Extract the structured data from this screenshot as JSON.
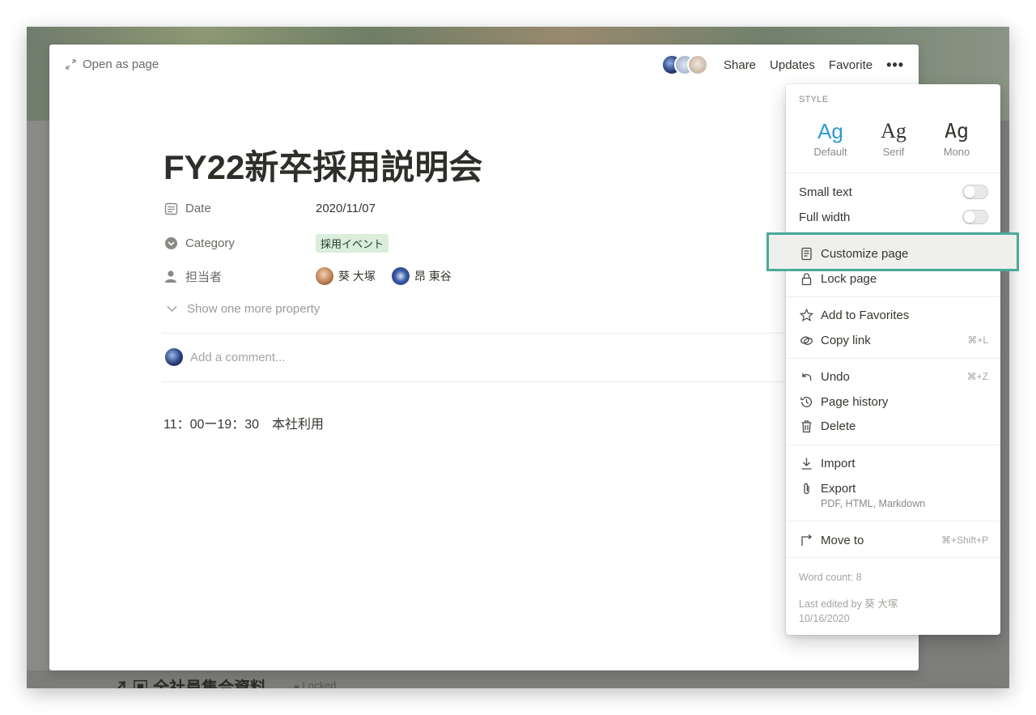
{
  "background": {
    "behind_title": "全社員集合資料",
    "behind_badge": "Locked"
  },
  "topbar": {
    "open_as_page": "Open as page",
    "share": "Share",
    "updates": "Updates",
    "favorite": "Favorite",
    "more": "•••"
  },
  "page": {
    "title": "FY22新卒採用説明会",
    "properties": [
      {
        "name": "Date",
        "icon": "calendar-icon",
        "value": "2020/11/07"
      },
      {
        "name": "Category",
        "icon": "select-icon",
        "value": "採用イベント"
      },
      {
        "name": "担当者",
        "icon": "person-icon",
        "people": [
          "葵 大塚",
          "昂 東谷"
        ]
      }
    ],
    "show_more": "Show one more property",
    "comment_placeholder": "Add a comment...",
    "body": "11：00ー19：30　本社利用"
  },
  "menu": {
    "style_label": "STYLE",
    "styles": [
      {
        "glyph": "Ag",
        "label": "Default",
        "selected": true
      },
      {
        "glyph": "Ag",
        "label": "Serif",
        "selected": false
      },
      {
        "glyph": "Ag",
        "label": "Mono",
        "selected": false
      }
    ],
    "small_text": "Small text",
    "full_width": "Full width",
    "customize_page": "Customize page",
    "lock_page": "Lock page",
    "add_to_favorites": "Add to Favorites",
    "copy_link": "Copy link",
    "copy_link_shortcut": "⌘+L",
    "undo": "Undo",
    "undo_shortcut": "⌘+Z",
    "page_history": "Page history",
    "delete": "Delete",
    "import": "Import",
    "export": "Export",
    "export_sub": "PDF, HTML, Markdown",
    "move_to": "Move to",
    "move_to_shortcut": "⌘+Shift+P",
    "word_count": "Word count: 8",
    "last_edited_by": "Last edited by 葵 大塚",
    "last_edited_date": "10/16/2020"
  },
  "colors": {
    "highlight_border": "#4aaa99",
    "selected_style": "#2f9bd1",
    "tag_bg": "#dbeddb"
  }
}
